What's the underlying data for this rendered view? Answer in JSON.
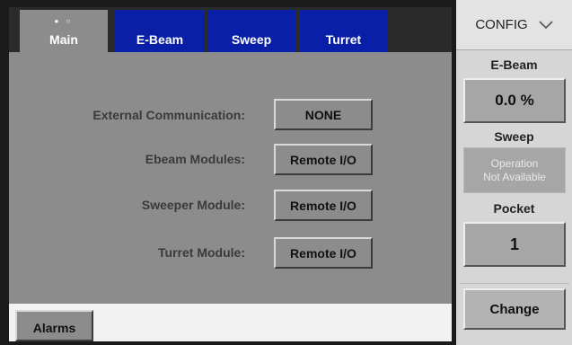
{
  "tabs": [
    {
      "label": "Main",
      "indicator": "● ○",
      "active": true
    },
    {
      "label": "E-Beam",
      "active": false
    },
    {
      "label": "Sweep",
      "active": false
    },
    {
      "label": "Turret",
      "active": false
    }
  ],
  "main": {
    "rows": [
      {
        "label": "External Communication:",
        "value": "NONE"
      },
      {
        "label": "Ebeam Modules:",
        "value": "Remote I/O"
      },
      {
        "label": "Sweeper Module:",
        "value": "Remote I/O"
      },
      {
        "label": "Turret Module:",
        "value": "Remote I/O"
      }
    ]
  },
  "bottom": {
    "alarms_label": "Alarms"
  },
  "side": {
    "config_label": "CONFIG",
    "config_icon": "chevron-down-icon",
    "ebeam_label": "E-Beam",
    "ebeam_value": "0.0 %",
    "sweep_label": "Sweep",
    "sweep_status": "Operation\nNot Available",
    "pocket_label": "Pocket",
    "pocket_value": "1",
    "change_label": "Change"
  },
  "colors": {
    "tab_active": "#8c8c8c",
    "tab_inactive": "#0a1fa8",
    "panel_bg": "#8c8c8c",
    "side_bg": "#d6d6d6"
  }
}
